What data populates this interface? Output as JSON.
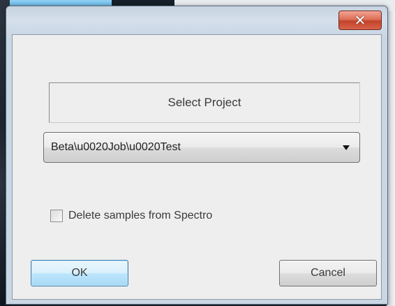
{
  "window": {
    "title": "",
    "close_icon": "close-icon"
  },
  "header": {
    "label": "Select Project"
  },
  "project_select": {
    "value": "Beta\\u0020Job\\u0020Test",
    "arrow_icon": "chevron-down-icon"
  },
  "delete_samples": {
    "label": "Delete samples from Spectro",
    "checked": false
  },
  "buttons": {
    "ok_label": "OK",
    "cancel_label": "Cancel"
  },
  "colors": {
    "ok_button_accent": "#3c7fb1",
    "close_button": "#c5432a"
  }
}
